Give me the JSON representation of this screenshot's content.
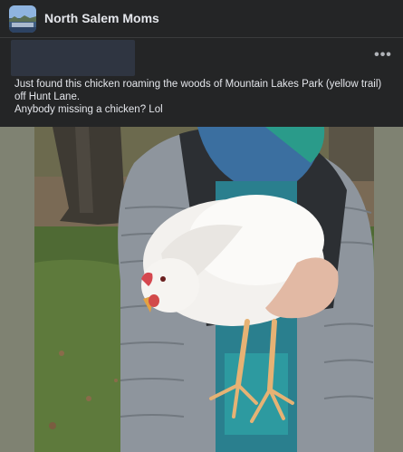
{
  "group": {
    "name": "North Salem Moms"
  },
  "post": {
    "lines": [
      "Just found this chicken roaming the woods of Mountain Lakes Park (yellow trail) off Hunt Lane.",
      "Anybody missing a chicken?  Lol"
    ],
    "more_label": "•••"
  },
  "icons": {
    "group_avatar": "group-cover-thumbnail",
    "more": "more-options-icon"
  },
  "colors": {
    "background": "#242526",
    "text": "#e4e6eb",
    "secondary_text": "#b0b3b8"
  }
}
